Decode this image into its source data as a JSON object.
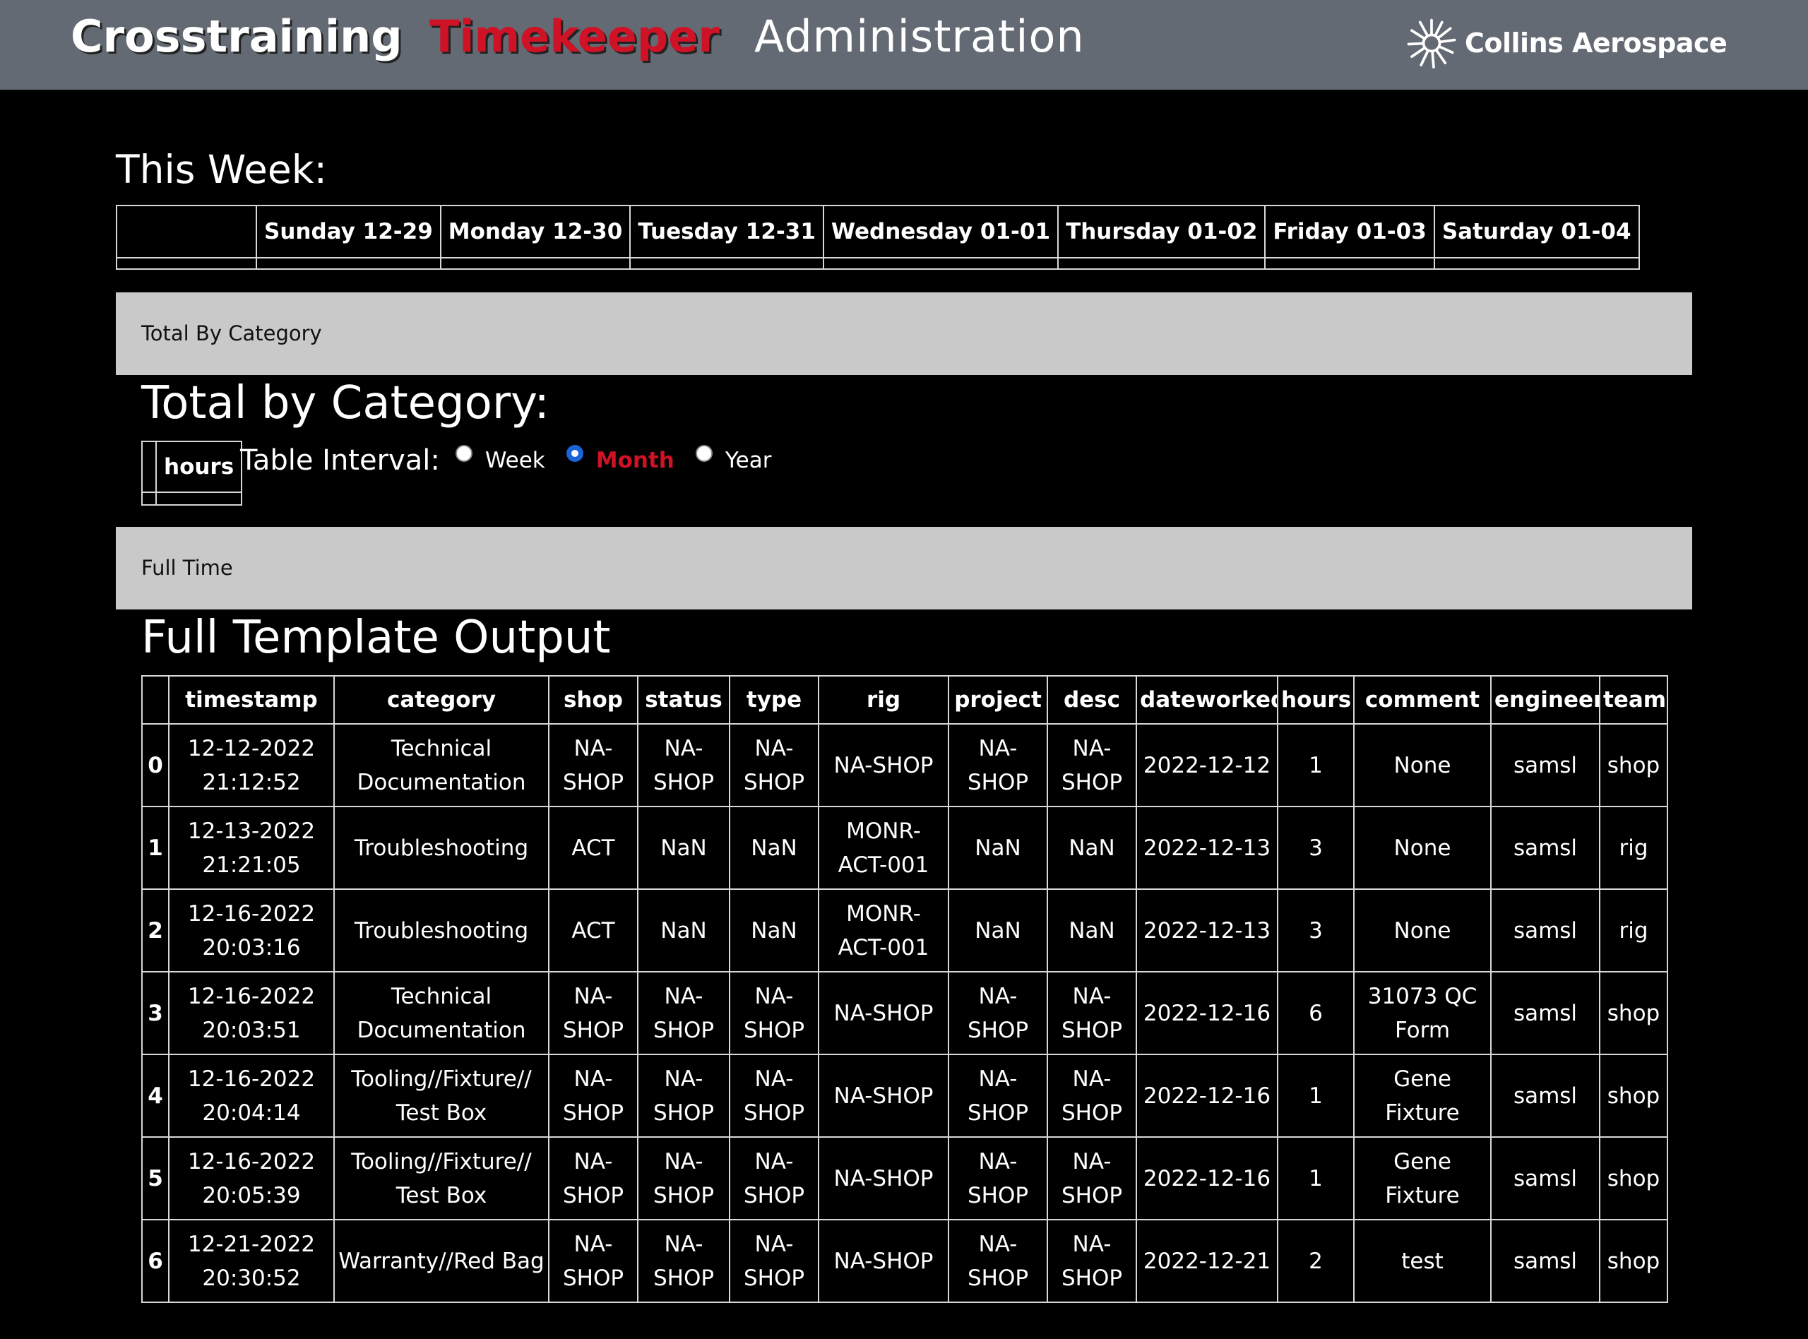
{
  "nav": {
    "crosstraining": "Crosstraining",
    "timekeeper": "Timekeeper",
    "administration": "Administration",
    "brand": "Collins Aerospace",
    "brand_icon": "collins-sunburst-logo",
    "active_color": "#cf1226"
  },
  "week": {
    "heading": "This Week:",
    "days": [
      "Sunday 12-29",
      "Monday 12-30",
      "Tuesday 12-31",
      "Wednesday 01-01",
      "Thursday 01-02",
      "Friday 01-03",
      "Saturday 01-04"
    ]
  },
  "category": {
    "banner": "Total By Category",
    "title": "Total by Category:",
    "hours_header": "hours",
    "interval_label": "Table Interval:",
    "options": [
      "Week",
      "Month",
      "Year"
    ],
    "selected": "Month"
  },
  "full": {
    "banner": "Full Time",
    "title": "Full Template Output",
    "columns": [
      "",
      "timestamp",
      "category",
      "shop",
      "status",
      "type",
      "rig",
      "project",
      "desc",
      "dateworked",
      "hours",
      "comment",
      "engineer",
      "team"
    ],
    "rows": [
      [
        "0",
        "12-12-2022 21:12:52",
        "Technical Documentation",
        "NA-SHOP",
        "NA-SHOP",
        "NA-SHOP",
        "NA-SHOP",
        "NA-SHOP",
        "NA-SHOP",
        "2022-12-12",
        "1",
        "None",
        "samsl",
        "shop"
      ],
      [
        "1",
        "12-13-2022 21:21:05",
        "Troubleshooting",
        "ACT",
        "NaN",
        "NaN",
        "MONR-ACT-001",
        "NaN",
        "NaN",
        "2022-12-13",
        "3",
        "None",
        "samsl",
        "rig"
      ],
      [
        "2",
        "12-16-2022 20:03:16",
        "Troubleshooting",
        "ACT",
        "NaN",
        "NaN",
        "MONR-ACT-001",
        "NaN",
        "NaN",
        "2022-12-13",
        "3",
        "None",
        "samsl",
        "rig"
      ],
      [
        "3",
        "12-16-2022 20:03:51",
        "Technical Documentation",
        "NA-SHOP",
        "NA-SHOP",
        "NA-SHOP",
        "NA-SHOP",
        "NA-SHOP",
        "NA-SHOP",
        "2022-12-16",
        "6",
        "31073 QC Form",
        "samsl",
        "shop"
      ],
      [
        "4",
        "12-16-2022 20:04:14",
        "Tooling//Fixture// Test Box",
        "NA-SHOP",
        "NA-SHOP",
        "NA-SHOP",
        "NA-SHOP",
        "NA-SHOP",
        "NA-SHOP",
        "2022-12-16",
        "1",
        "Gene Fixture",
        "samsl",
        "shop"
      ],
      [
        "5",
        "12-16-2022 20:05:39",
        "Tooling//Fixture// Test Box",
        "NA-SHOP",
        "NA-SHOP",
        "NA-SHOP",
        "NA-SHOP",
        "NA-SHOP",
        "NA-SHOP",
        "2022-12-16",
        "1",
        "Gene Fixture",
        "samsl",
        "shop"
      ],
      [
        "6",
        "12-21-2022 20:30:52",
        "Warranty//Red Bag",
        "NA-SHOP",
        "NA-SHOP",
        "NA-SHOP",
        "NA-SHOP",
        "NA-SHOP",
        "NA-SHOP",
        "2022-12-21",
        "2",
        "test",
        "samsl",
        "shop"
      ]
    ]
  }
}
